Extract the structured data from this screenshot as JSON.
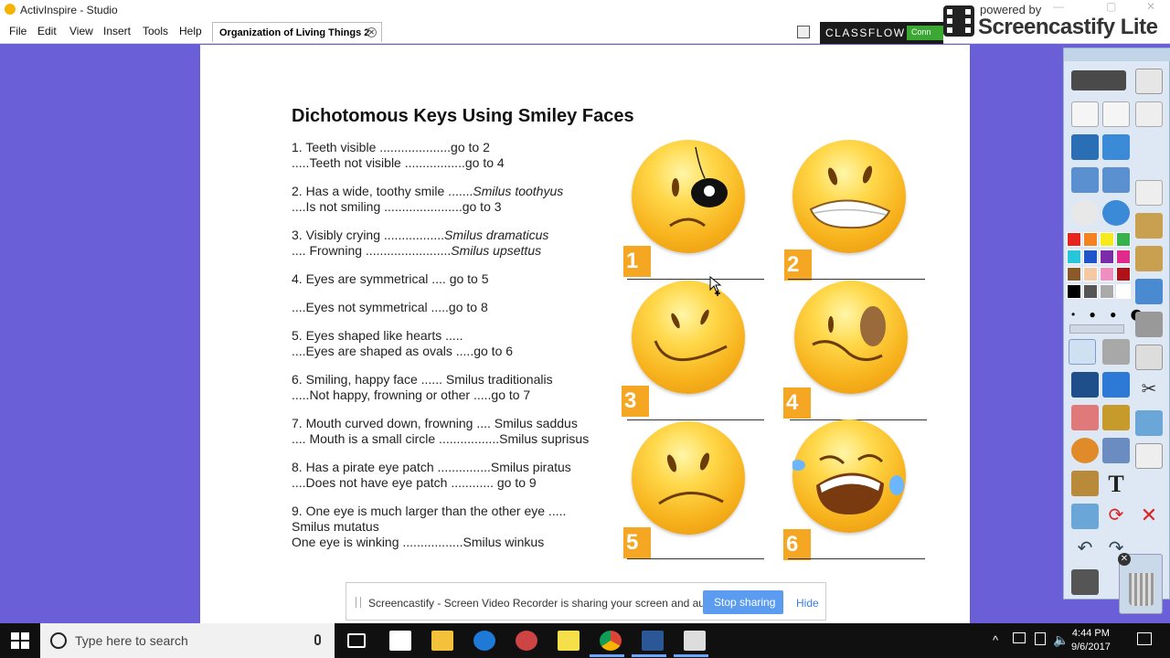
{
  "window": {
    "title": "ActivInspire - Studio",
    "menu": [
      "File",
      "Edit",
      "View",
      "Insert",
      "Tools",
      "Help"
    ],
    "doc_tab": "Organization of Living Things 2",
    "classflow_label": "CLASSFLOW",
    "classflow_connect": "Conn",
    "watermark_small": "powered by",
    "watermark_big": "Screencastify Lite"
  },
  "worksheet": {
    "title": "Dichotomous Keys Using Smiley Faces",
    "blocks": [
      {
        "lines": [
          {
            "text": "1. Teeth visible ....................go to 2",
            "italic": ""
          },
          {
            "text": ".....Teeth not visible .................go to 4",
            "italic": ""
          }
        ]
      },
      {
        "lines": [
          {
            "text": "2. Has a wide, toothy smile .......",
            "italic": "Smilus toothyus"
          },
          {
            "text": "....Is not smiling ......................go to 3",
            "italic": ""
          }
        ]
      },
      {
        "lines": [
          {
            "text": "3. Visibly crying .................",
            "italic": "Smilus dramaticus"
          },
          {
            "text": ".... Frowning ........................",
            "italic": "Smilus upsettus"
          }
        ]
      },
      {
        "lines": [
          {
            "text": "4. Eyes are symmetrical .... go to 5",
            "italic": ""
          }
        ]
      },
      {
        "lines": [
          {
            "text": "....Eyes not symmetrical .....go to 8",
            "italic": ""
          }
        ]
      },
      {
        "lines": [
          {
            "text": "5. Eyes shaped like hearts .....",
            "italic": ""
          },
          {
            "text": "....Eyes are shaped as ovals .....go to 6",
            "italic": ""
          }
        ]
      },
      {
        "lines": [
          {
            "text": "6. Smiling, happy face ...... Smilus traditionalis",
            "italic": ""
          },
          {
            "text": ".....Not happy, frowning or other .....go to 7",
            "italic": ""
          }
        ]
      },
      {
        "lines": [
          {
            "text": "7. Mouth curved down, frowning .... Smilus saddus",
            "italic": ""
          },
          {
            "text": ".... Mouth is a small circle .................Smilus suprisus",
            "italic": ""
          }
        ]
      },
      {
        "lines": [
          {
            "text": "8. Has a pirate eye patch ...............Smilus piratus",
            "italic": ""
          },
          {
            "text": "....Does not have eye patch ............ go to 9",
            "italic": ""
          }
        ]
      },
      {
        "lines": [
          {
            "text": "9. One eye is much larger than the other eye .....",
            "italic": ""
          },
          {
            "text": "Smilus mutatus",
            "italic": ""
          },
          {
            "text": "One eye is winking .................Smilus winkus",
            "italic": ""
          }
        ]
      }
    ],
    "face_numbers": [
      "1",
      "2",
      "3",
      "4",
      "5",
      "6"
    ],
    "face_names": [
      "pirate-face",
      "toothy-face",
      "smiling-face",
      "uneven-eye-face",
      "frowning-face",
      "crying-face"
    ]
  },
  "screencastify_bar": {
    "message": "Screencastify - Screen Video Recorder is sharing your screen and audio.",
    "stop_label": "Stop sharing",
    "hide_label": "Hide"
  },
  "toolbox": {
    "colors": [
      "#e8241f",
      "#f58220",
      "#f7ea1a",
      "#36b34a",
      "#27c6d8",
      "#1f55c9",
      "#7b2ca8",
      "#e02a8c",
      "#8a5a2b",
      "#f5c9a4",
      "#f08ec2",
      "#b0121a",
      "#000000",
      "#555555",
      "#aaaaaa",
      "#ffffff"
    ]
  },
  "taskbar": {
    "search_placeholder": "Type here to search",
    "time": "4:44 PM",
    "date": "9/6/2017"
  }
}
